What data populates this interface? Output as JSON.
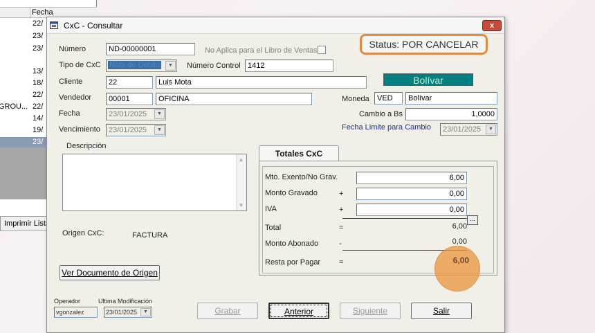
{
  "background_list": {
    "column_header": "Fecha",
    "rows": [
      {
        "c1": "",
        "c2": "22/"
      },
      {
        "c1": "",
        "c2": "23/"
      },
      {
        "c1": "",
        "c2": "23/"
      },
      {
        "c1": "",
        "c2": "13/"
      },
      {
        "c1": "",
        "c2": "18/"
      },
      {
        "c1": "",
        "c2": "22/"
      },
      {
        "c1": "GROU...",
        "c2": "22/"
      },
      {
        "c1": "",
        "c2": "14/"
      },
      {
        "c1": "",
        "c2": "19/"
      },
      {
        "c1": "",
        "c2": "23/"
      }
    ],
    "print_button": "Imprimir Lista"
  },
  "dialog": {
    "title": "CxC - Consultar",
    "close_label": "x"
  },
  "status": "Status: POR CANCELAR",
  "form": {
    "numero_label": "Número",
    "numero_value": "ND-00000001",
    "no_aplica_label": "No Aplica para el Libro de Ventas",
    "tipo_label": "Tipo de CxC",
    "tipo_value": "Nota de Debito",
    "numero_control_label": "Número Control",
    "numero_control_value": "1412",
    "cliente_label": "Cliente",
    "cliente_code": "22",
    "cliente_name": "Luis Mota",
    "vendedor_label": "Vendedor",
    "vendedor_code": "00001",
    "vendedor_name": "OFICINA",
    "fecha_label": "Fecha",
    "fecha_value": "23/01/2025",
    "vencimiento_label": "Vencimiento",
    "vencimiento_value": "23/01/2025",
    "currency_banner": "Bolívar",
    "moneda_label": "Moneda",
    "moneda_code": "VED",
    "moneda_name": "Bolívar",
    "cambio_label": "Cambio a Bs",
    "cambio_value": "1,0000",
    "fecha_limite_label": "Fecha Limite para Cambio",
    "fecha_limite_value": "23/01/2025",
    "descripcion_label": "Descripción",
    "origen_label": "Origen CxC:",
    "origen_value": "FACTURA",
    "ver_documento_button": "Ver Documento de Origen",
    "operador_label": "Operador",
    "operador_value": "vgonzalez",
    "ultima_mod_label": "Ultima Modificación",
    "ultima_mod_value": "23/01/2025"
  },
  "totals": {
    "tab_label": "Totales CxC",
    "exento_label": "Mto. Exento/No Grav.",
    "exento_value": "6,00",
    "gravado_label": "Monto Gravado",
    "gravado_sign": "+",
    "gravado_value": "0,00",
    "iva_label": "IVA",
    "iva_sign": "+",
    "iva_value": "0,00",
    "total_label": "Total",
    "total_sign": "=",
    "total_value": "6,00",
    "abonado_label": "Monto Abonado",
    "abonado_sign": "-",
    "abonado_value": "0,00",
    "resta_label": "Resta por Pagar",
    "resta_sign": "=",
    "resta_value": "6,00",
    "ellipsis": "..."
  },
  "buttons": {
    "grabar": "Grabar",
    "anterior": "Anterior",
    "siguiente": "Siguiente",
    "salir": "Salir"
  },
  "colors": {
    "status_border": "#e38a3f",
    "currency_banner_bg": "#008080",
    "highlight_circle": "#eb963c"
  }
}
